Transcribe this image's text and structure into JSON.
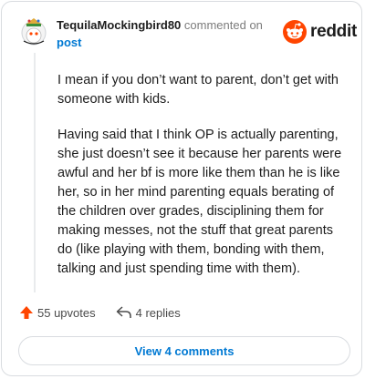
{
  "comment": {
    "username": "TequilaMockingbird80",
    "commented_text": "commented on",
    "post_link": "post",
    "paragraphs": [
      "I mean if you don’t want to parent, don’t get with someone with kids.",
      "Having said that I think OP is actually parenting, she just doesn’t see it because her parents were awful and her bf is more like them than he is like her, so in her mind parenting equals berating of the children over grades, disciplining them for making messes, not the stuff that great parents do (like playing with them, bonding with them, talking and just spending time with them)."
    ]
  },
  "brand": {
    "name": "reddit",
    "color": "#ff4500"
  },
  "actions": {
    "upvotes": "55 upvotes",
    "replies": "4 replies"
  },
  "footer": {
    "view_comments": "View 4 comments"
  },
  "colors": {
    "accent": "#0079d3",
    "upvote": "#ff4500"
  }
}
